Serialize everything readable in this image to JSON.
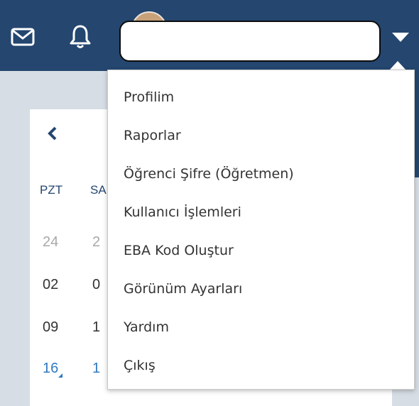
{
  "header": {
    "mail_icon": "mail-icon",
    "bell_icon": "bell-icon",
    "dropdown_caret_icon": "chevron-down-icon",
    "bar_color": "#24466f"
  },
  "calendar": {
    "prev_icon": "chevron-left-icon",
    "day_headers": [
      "PZT",
      "SA"
    ],
    "rows": [
      [
        "24",
        "2"
      ],
      [
        "02",
        "0"
      ],
      [
        "09",
        "1"
      ],
      [
        "16",
        "1"
      ]
    ]
  },
  "user_menu": {
    "items": [
      "Profilim",
      "Raporlar",
      "Öğrenci Şifre (Öğretmen)",
      "Kullanıcı İşlemleri",
      "EBA Kod Oluştur",
      "Görünüm Ayarları",
      "Yardım",
      "Çıkış"
    ]
  }
}
